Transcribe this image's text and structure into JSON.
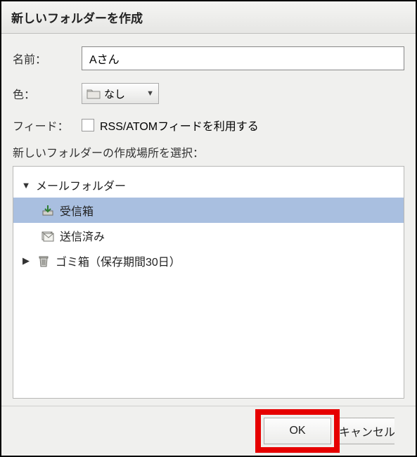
{
  "dialog": {
    "title": "新しいフォルダーを作成"
  },
  "form": {
    "name_label": "名前：",
    "name_value": "Aさん",
    "color_label": "色：",
    "color_value": "なし",
    "feed_label": "フィード：",
    "feed_checkbox_label": "RSS/ATOMフィードを利用する"
  },
  "section": {
    "location_label": "新しいフォルダーの作成場所を選択："
  },
  "tree": {
    "root": {
      "label": "メールフォルダー",
      "expanded": true,
      "children": [
        {
          "label": "受信箱",
          "icon": "inbox",
          "selected": true
        },
        {
          "label": "送信済み",
          "icon": "sent",
          "selected": false
        }
      ]
    },
    "trash": {
      "label": "ゴミ箱（保存期間30日）",
      "expanded": false
    }
  },
  "buttons": {
    "ok": "OK",
    "cancel": "キャンセル"
  }
}
